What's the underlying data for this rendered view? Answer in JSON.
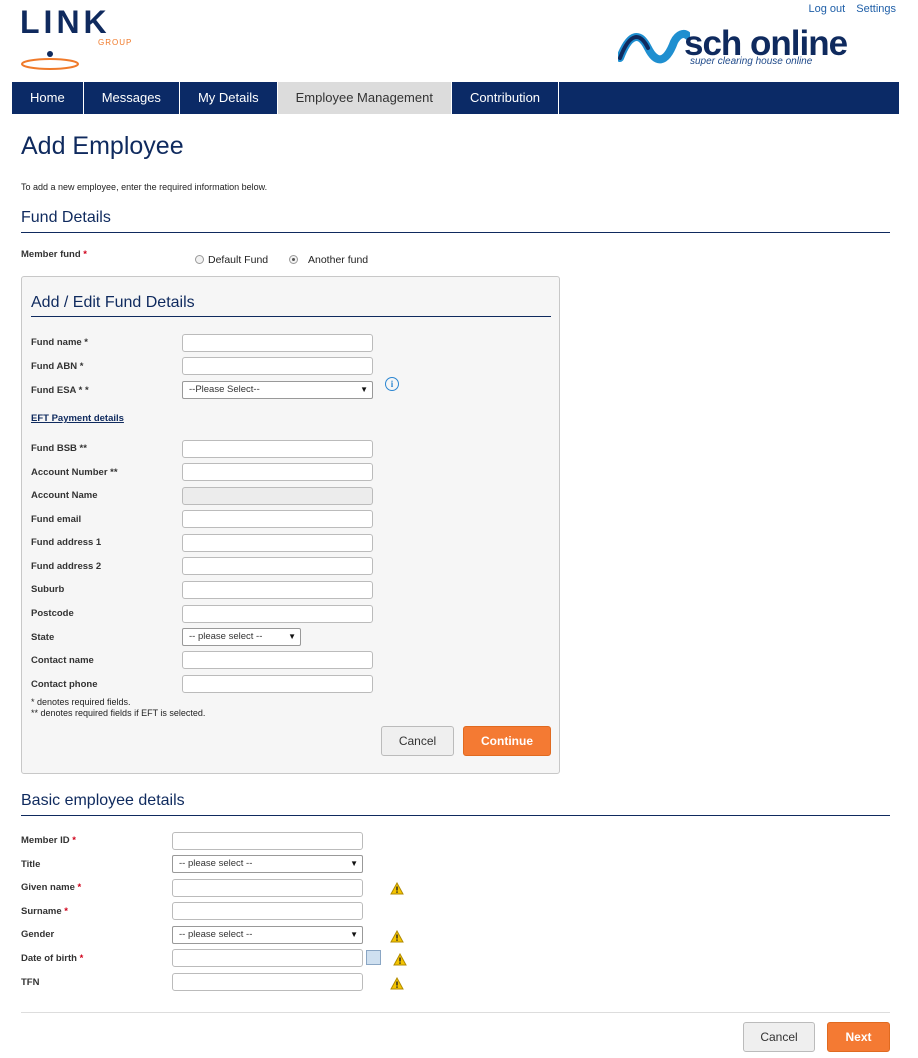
{
  "header": {
    "logout": "Log out",
    "settings": "Settings",
    "link_logo_text": "LINK",
    "link_logo_sub": "GROUP",
    "sch_logo_text": "sch online",
    "sch_tagline": "super clearing house online"
  },
  "nav": [
    "Home",
    "Messages",
    "My Details",
    "Employee Management",
    "Contribution"
  ],
  "nav_active": 3,
  "page_title": "Add Employee",
  "intro": "To add a new employee, enter the required information below.",
  "fund_section": {
    "heading": "Fund Details",
    "member_fund_label": "Member fund",
    "req_mark": "*",
    "option_default": "Default Fund",
    "option_another": "Another fund"
  },
  "panel": {
    "heading": "Add / Edit Fund Details",
    "fields": {
      "fund_name": "Fund name *",
      "fund_abn": "Fund ABN *",
      "fund_esa": "Fund ESA * *",
      "fund_esa_placeholder": "--Please Select--",
      "eft_heading": "EFT Payment details",
      "fund_bsb": "Fund BSB **",
      "account_number": "Account Number **",
      "account_name": "Account Name",
      "fund_email": "Fund email",
      "fund_address1": "Fund address 1",
      "fund_address2": "Fund address 2",
      "suburb": "Suburb",
      "postcode": "Postcode",
      "state": "State",
      "state_placeholder": "-- please select --",
      "contact_name": "Contact name",
      "contact_phone": "Contact phone"
    },
    "note1": "* denotes required fields.",
    "note2": "** denotes required fields if EFT is selected.",
    "cancel": "Cancel",
    "continue": "Continue"
  },
  "employee_section": {
    "heading": "Basic employee details",
    "member_id": "Member ID",
    "title": "Title",
    "title_placeholder": "-- please select --",
    "given_name": "Given name",
    "surname": "Surname",
    "gender": "Gender",
    "gender_placeholder": "-- please select --",
    "dob": "Date of birth",
    "tfn": "TFN",
    "req_mark": "*"
  },
  "footer": {
    "cancel": "Cancel",
    "next": "Next"
  }
}
